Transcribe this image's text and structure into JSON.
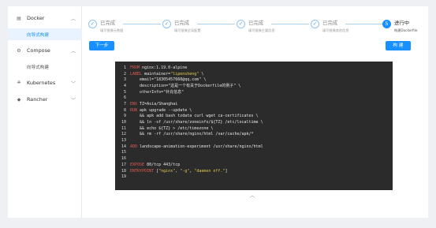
{
  "sidebar": {
    "groups": [
      {
        "icon": "docker-icon",
        "label": "Docker",
        "sub": [
          "向导式构建"
        ]
      },
      {
        "icon": "compose-icon",
        "label": "Compose",
        "sub": [
          "向导式构建"
        ]
      },
      {
        "icon": "kubernetes-icon",
        "label": "Kubernetes",
        "sub": []
      },
      {
        "icon": "rancher-icon",
        "label": "Rancher",
        "sub": []
      }
    ]
  },
  "steps": [
    {
      "status": "done",
      "title": "已完成",
      "desc": "填写镜像元数据"
    },
    {
      "status": "done",
      "title": "已完成",
      "desc": "填写镜像全局配置"
    },
    {
      "status": "done",
      "title": "已完成",
      "desc": "填写镜像主要信息"
    },
    {
      "status": "done",
      "title": "已完成",
      "desc": "填写镜像其他信息"
    },
    {
      "status": "active",
      "number": "5",
      "title": "进行中",
      "desc": "构建Dockerfile"
    }
  ],
  "buttons": {
    "prev": "下一步",
    "build": "构 建"
  },
  "code": [
    {
      "n": "1",
      "parts": [
        {
          "t": "kw",
          "v": "FROM"
        },
        {
          "t": "plain",
          "v": " nginx:1.19.0-alpine"
        }
      ]
    },
    {
      "n": "2",
      "parts": [
        {
          "t": "kw",
          "v": "LABEL"
        },
        {
          "t": "plain",
          "v": " maintainer="
        },
        {
          "t": "str",
          "v": "\"lipensheng\""
        },
        {
          "t": "plain",
          "v": " \\"
        }
      ]
    },
    {
      "n": "3",
      "parts": [
        {
          "t": "plain",
          "v": "    email=\"18305457660@qq.com\" \\"
        }
      ]
    },
    {
      "n": "4",
      "parts": [
        {
          "t": "plain",
          "v": "    description=\"这是一个有关于Dockerfile的例子\" \\"
        }
      ]
    },
    {
      "n": "5",
      "parts": [
        {
          "t": "plain",
          "v": "    otherInfo=\"补充信息\""
        }
      ]
    },
    {
      "n": "6",
      "parts": [
        {
          "t": "plain",
          "v": ""
        }
      ]
    },
    {
      "n": "7",
      "parts": [
        {
          "t": "kw",
          "v": "ENV"
        },
        {
          "t": "plain",
          "v": " TZ=Asia/Shanghai"
        }
      ]
    },
    {
      "n": "8",
      "parts": [
        {
          "t": "kw",
          "v": "RUN"
        },
        {
          "t": "plain",
          "v": " apk upgrade --update \\"
        }
      ]
    },
    {
      "n": "9",
      "parts": [
        {
          "t": "plain",
          "v": "    && apk add bash tzdata curl wget ca-certificates \\"
        }
      ]
    },
    {
      "n": "10",
      "parts": [
        {
          "t": "plain",
          "v": "    && ln -sf /usr/share/zoneinfo/${TZ} /etc/localtime \\"
        }
      ]
    },
    {
      "n": "11",
      "parts": [
        {
          "t": "plain",
          "v": "    && echo ${TZ} > /etc/timezone \\"
        }
      ]
    },
    {
      "n": "12",
      "parts": [
        {
          "t": "plain",
          "v": "    && rm -rf /usr/share/nginx/html /var/cache/apk/*"
        }
      ]
    },
    {
      "n": "13",
      "parts": [
        {
          "t": "plain",
          "v": ""
        }
      ]
    },
    {
      "n": "14",
      "parts": [
        {
          "t": "kw",
          "v": "ADD"
        },
        {
          "t": "plain",
          "v": " landscape-animation-experiment /usr/share/nginx/html"
        }
      ]
    },
    {
      "n": "15",
      "parts": [
        {
          "t": "plain",
          "v": ""
        }
      ]
    },
    {
      "n": "16",
      "parts": [
        {
          "t": "plain",
          "v": ""
        }
      ]
    },
    {
      "n": "17",
      "parts": [
        {
          "t": "kw",
          "v": "EXPOSE"
        },
        {
          "t": "plain",
          "v": " 80/tcp 443/tcp"
        }
      ]
    },
    {
      "n": "18",
      "parts": [
        {
          "t": "kw",
          "v": "ENTRYPOINT"
        },
        {
          "t": "plain",
          "v": " ["
        },
        {
          "t": "str",
          "v": "\"nginx\""
        },
        {
          "t": "plain",
          "v": ", "
        },
        {
          "t": "str",
          "v": "\"-g\""
        },
        {
          "t": "plain",
          "v": ", "
        },
        {
          "t": "str",
          "v": "\"daemon off.\""
        },
        {
          "t": "plain",
          "v": "]"
        }
      ]
    },
    {
      "n": "19",
      "parts": [
        {
          "t": "plain",
          "v": ""
        }
      ]
    }
  ],
  "icons": {
    "collapse": "chevron-up-icon",
    "done": "check-icon"
  },
  "colors": {
    "primary": "#1890ff",
    "code_bg": "#2b2b2b",
    "keyword": "#e05a4f",
    "string": "#e4c94a"
  }
}
